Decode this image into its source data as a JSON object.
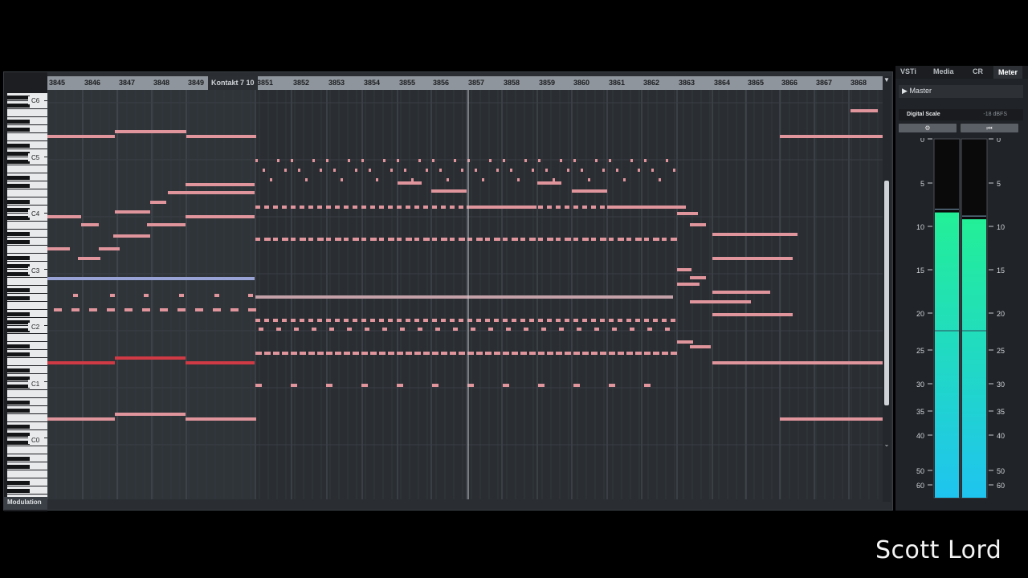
{
  "editor": {
    "bars": [
      "3845",
      "3846",
      "3847",
      "3848",
      "3849",
      "3851",
      "3852",
      "3853",
      "3854",
      "3855",
      "3856",
      "3857",
      "3858",
      "3859",
      "3860",
      "3861",
      "3862",
      "3863",
      "3864",
      "3865",
      "3866",
      "3867",
      "3868"
    ],
    "track_label": "Kontakt 7 10",
    "octave_labels": [
      "C6",
      "C5",
      "C4",
      "C3",
      "C2",
      "C1",
      "C0"
    ],
    "controller_lane": "Modulation",
    "scroll_up_icon": "triangle-up-icon",
    "scroll_down_icon": "chevron-down-icon"
  },
  "right_panel": {
    "tabs": [
      "VSTi",
      "Media",
      "CR",
      "Meter"
    ],
    "active_tab": "Meter",
    "master_label": "Master",
    "scale_label": "Digital Scale",
    "scale_value": "-18 dBFS",
    "settings_icon": "gear-icon",
    "reset_icon": "skip-back-icon",
    "meter_scale": [
      "0",
      "5",
      "10",
      "15",
      "20",
      "25",
      "30",
      "35",
      "40",
      "50",
      "60"
    ],
    "meter_levels": {
      "left": 0.795,
      "right": 0.776
    }
  },
  "watermark": "Scott Lord",
  "colors": {
    "note": "#e0949c",
    "note_highlight": "#f0a0a6",
    "note_red": "#cf3a44",
    "note_blue": "#9aa3d6",
    "meter_top": "#23ef97",
    "meter_bottom": "#1fc4ef"
  }
}
